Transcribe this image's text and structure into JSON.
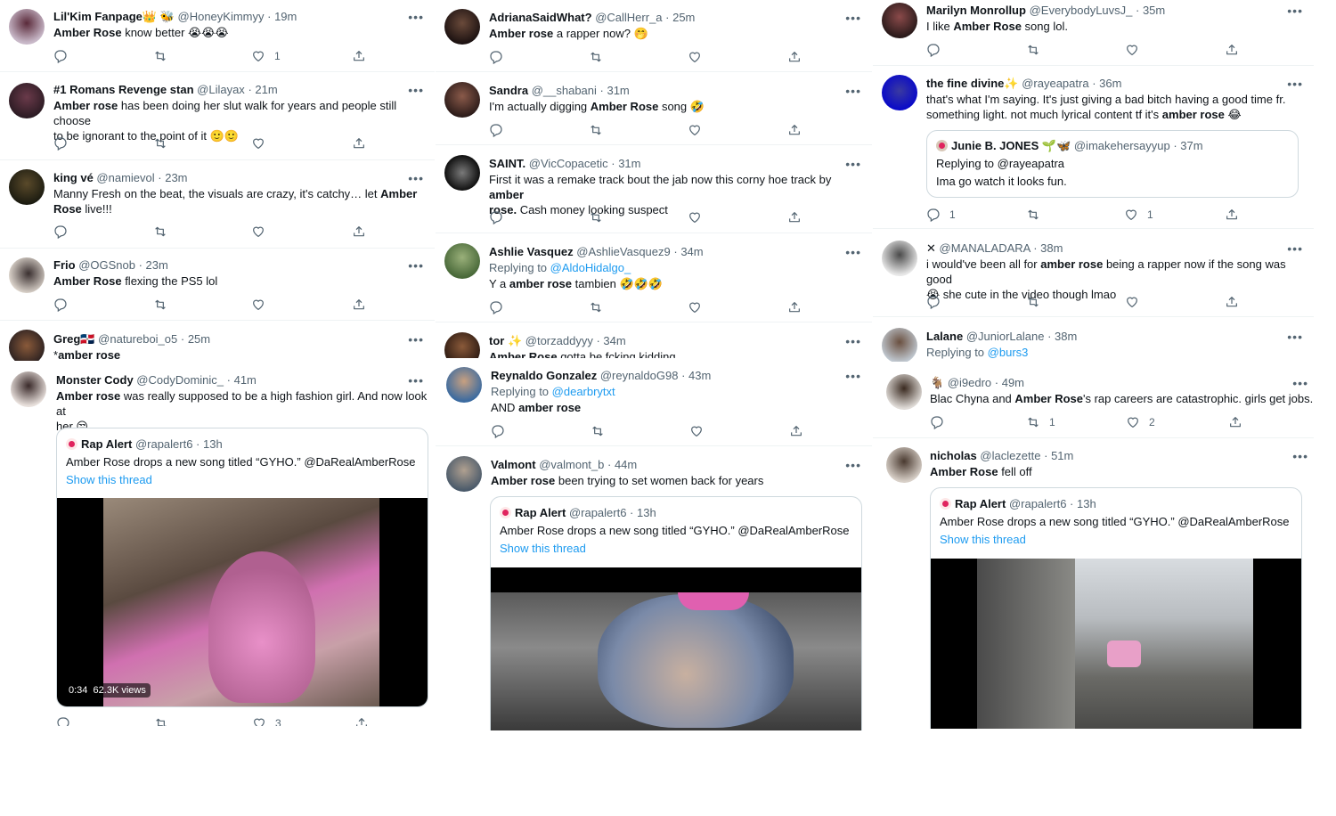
{
  "col1": [
    {
      "name": "Lil'Kim Fanpage👑 🐝",
      "handle": "@HoneyKimmyy",
      "time": "· 19m",
      "b1": "Amber Rose",
      "t1": " know better 😭😭😭",
      "like": "1"
    },
    {
      "name": "#1 Romans Revenge stan",
      "handle": "@Lilayax",
      "time": "· 21m",
      "b1": "Amber rose",
      "t1": " has been doing her slut walk for years and people still choose",
      "t2": "to be ignorant to the point of it 🙂🙂"
    },
    {
      "name": "king vé",
      "handle": "@namievol",
      "time": "· 23m",
      "t0": "Manny Fresh on the beat, the visuals are crazy, it's catchy… let ",
      "b1": "Amber",
      "t1": "",
      "b2": "Rose",
      "t2": " live!!!"
    },
    {
      "name": "Frio",
      "handle": "@OGSnob",
      "time": "· 23m",
      "b1": "Amber Rose",
      "t1": " flexing the PS5 lol"
    },
    {
      "name": "Greg🇩🇴",
      "handle": "@natureboi_o5",
      "time": "· 25m",
      "t0": "*",
      "b1": "amber rose"
    },
    {
      "name": "Monster Cody",
      "handle": "@CodyDominic_",
      "time": "· 41m",
      "b1": "Amber rose",
      "t1": " was really supposed to be a high fashion girl. And now look at",
      "t2": "her 😒",
      "q_name": "Rap Alert",
      "q_handle": "@rapalert6 · 13h",
      "q_text": "Amber Rose drops a new song titled “GYHO.” @DaRealAmberRose",
      "q_link": "Show this thread",
      "video_time": "0:34",
      "video_views": "62.3K views",
      "like": "3"
    }
  ],
  "col2": [
    {
      "name": "AdrianaSaidWhat?",
      "handle": "@CallHerr_a",
      "time": "· 25m",
      "b1": "Amber rose",
      "t1": " a rapper now? 🤭"
    },
    {
      "name": "Sandra",
      "handle": "@__shabani",
      "time": "· 31m",
      "t0": "I'm actually digging ",
      "b1": "Amber Rose",
      "t1": " song 🤣"
    },
    {
      "name": "SAINT.",
      "handle": "@VicCopacetic",
      "time": "· 31m",
      "t0": "First it was a remake track bout the jab now this corny hoe track by ",
      "b1": "amber",
      "b2": "rose.",
      "t2": " Cash money looking suspect"
    },
    {
      "name": "Ashlie Vasquez",
      "handle": "@AshlieVasquez9",
      "time": "· 34m",
      "reply_pre": "Replying to ",
      "reply_to": "@AldoHidalgo_",
      "t0": "Y a ",
      "b1": "amber rose",
      "t1": " tambien 🤣🤣🤣"
    },
    {
      "name": "tor ✨",
      "handle": "@torzaddyyy",
      "time": "· 34m",
      "b1": "Amber Rose",
      "t1": " gotta be fcking kidding"
    },
    {
      "name": "Reynaldo Gonzalez",
      "handle": "@reynaldoG98",
      "time": "· 43m",
      "reply_pre": "Replying to ",
      "reply_to": "@dearbrytxt",
      "t0": "AND ",
      "b1": "amber rose"
    },
    {
      "name": "Valmont",
      "handle": "@valmont_b",
      "time": "· 44m",
      "b1": "Amber rose",
      "t1": " been trying to set women back for years",
      "q_name": "Rap Alert",
      "q_handle": "@rapalert6 · 13h",
      "q_text": "Amber Rose drops a new song titled “GYHO.” @DaRealAmberRose",
      "q_link": "Show this thread"
    }
  ],
  "col3": [
    {
      "name": "Marilyn Monrollup",
      "handle": "@EverybodyLuvsJ_",
      "time": "· 35m",
      "t0": "I like ",
      "b1": "Amber Rose",
      "t1": " song lol."
    },
    {
      "name": "the fine divine✨",
      "handle": "@rayeapatra",
      "time": "· 36m",
      "t0": "that's what I'm saying. It's just giving a bad bitch having a good time fr.",
      "t1": "something light. not much lyrical content tf it's ",
      "b1": "amber rose",
      "t2": " 😂",
      "q_name": "Junie B. JONES 🌱🦋",
      "q_handle": "@imakehersayyup · 37m",
      "q_reply_pre": "Replying to ",
      "q_reply_to": "@rayeapatra",
      "q_text": "Ima go watch it looks fun.",
      "reply": "1",
      "like": "1"
    },
    {
      "name": "✕",
      "handle": "@MANALADARA",
      "time": "· 38m",
      "t0": "i would've been all for ",
      "b1": "amber rose",
      "t1": " being a rapper now if the song was good",
      "t2": "😭 she cute in the video though lmao"
    },
    {
      "name": "Lalane",
      "handle": "@JuniorLalane",
      "time": "· 38m",
      "reply_pre": "Replying to ",
      "reply_to": "@burs3"
    },
    {
      "name": "🐐",
      "handle": "@i9edro",
      "time": "· 49m",
      "t0": "Blac Chyna and ",
      "b1": "Amber Rose",
      "t1": "'s rap careers are catastrophic. girls get jobs.",
      "retweet": "1",
      "like": "2"
    },
    {
      "name": "nicholas",
      "handle": "@laclezette",
      "time": "· 51m",
      "b1": "Amber Rose",
      "t1": " fell off",
      "q_name": "Rap Alert",
      "q_handle": "@rapalert6 · 13h",
      "q_text": "Amber Rose drops a new song titled “GYHO.” @DaRealAmberRose",
      "q_link": "Show this thread"
    }
  ],
  "more": "•••"
}
